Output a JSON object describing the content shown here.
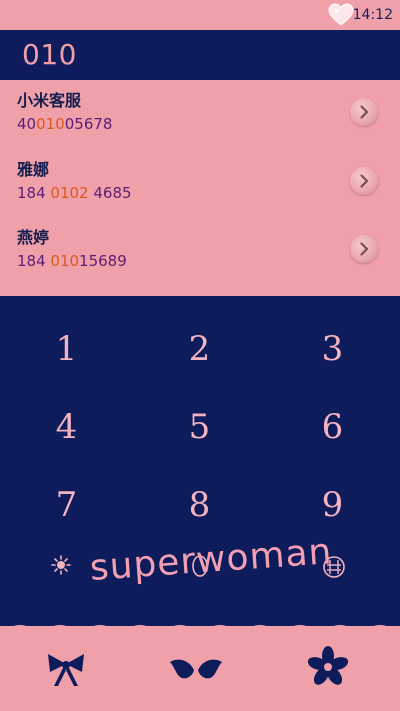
{
  "status_bar": {
    "time": "14:12",
    "heart_icon": "heart-icon"
  },
  "dialer": {
    "number": "010"
  },
  "contacts": [
    {
      "name": "小米客服",
      "number_pre": "40",
      "number_match": "010",
      "number_post": "05678"
    },
    {
      "name": "雅娜",
      "number_pre": "184 ",
      "number_match": "0102",
      "number_post": " 4685"
    },
    {
      "name": "燕婷",
      "number_pre": "184 ",
      "number_match": "010",
      "number_post": "15689"
    }
  ],
  "keypad": {
    "keys": [
      "1",
      "2",
      "3",
      "4",
      "5",
      "6",
      "7",
      "8",
      "9"
    ],
    "bottom_row_icons": [
      "sun-star-icon",
      "zero-icon",
      "hash-icon"
    ]
  },
  "overlay": {
    "text": "superwoman"
  },
  "bottom_nav": {
    "items": [
      "bow-icon",
      "wings-icon",
      "flower-icon"
    ]
  },
  "colors": {
    "pink": "#f0a0a8",
    "navy": "#0e1c5c",
    "match_highlight": "#d95a1f",
    "number_text": "#5a1e78"
  }
}
